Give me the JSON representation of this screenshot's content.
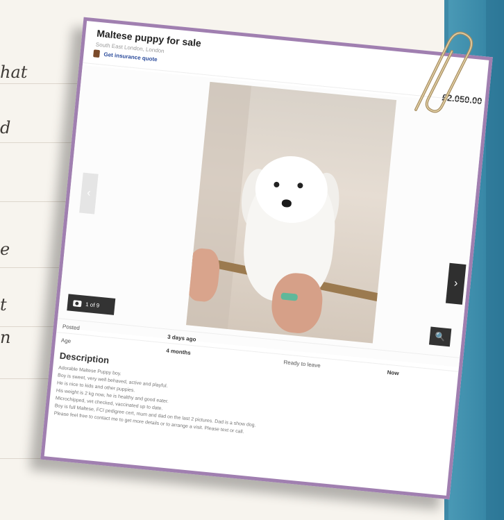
{
  "notes": {
    "lines": [
      "hat",
      "d",
      "",
      "e",
      "t",
      "n"
    ]
  },
  "listing": {
    "title": "Maltese puppy for sale",
    "location": "South East London, London",
    "insurance_link": "Get insurance quote",
    "price": "£2,050.00",
    "gallery": {
      "counter": "1 of 9",
      "prev_symbol": "‹",
      "next_symbol": "›",
      "zoom_symbol": "🔍"
    },
    "details": {
      "posted_label": "Posted",
      "posted_value": "3 days ago",
      "age_label": "Age",
      "age_value": "4 months",
      "ready_label": "Ready to leave",
      "ready_value": "Now"
    },
    "description_heading": "Description",
    "description_lines": [
      "Adorable Maltese Puppy boy.",
      "Boy is sweet, very well behaved, active and playful.",
      "He is nice to kids and other puppies.",
      "His weight is 2 kg now, he is healthy and good eater.",
      "Microchipped, vet checked, vaccinated up to date.",
      "Boy is full Maltese, FCI pedigree cert, mum and dad on the last 2 pictures. Dad is a show dog.",
      "Please feel free to contact me to get more details or to arrange a visit. Please text or call."
    ]
  },
  "colors": {
    "card_border": "#a07fb0",
    "side_panel": "#3f8aa8",
    "link": "#2b4b9b"
  }
}
